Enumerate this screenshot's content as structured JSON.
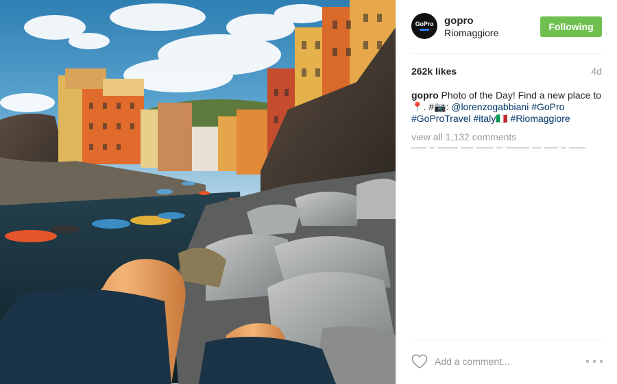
{
  "header": {
    "avatar_text": "GoPro",
    "username": "gopro",
    "location": "Riomaggiore",
    "follow_label": "Following"
  },
  "stats": {
    "likes": "262k likes",
    "age": "4d"
  },
  "caption": {
    "user": "gopro",
    "text_1": " Photo of the Day! Find a new place to ",
    "pin_emoji": "📍",
    "text_2": ". #",
    "camera_emoji": "📷",
    "text_3": ": ",
    "mention": "@lorenzogabbiani",
    "text_4": " ",
    "tag_1": "#GoPro",
    "text_5": " ",
    "tag_2": "#GoProTravel",
    "text_6": " ",
    "tag_3": "#italy",
    "flag_emoji": "🇮🇹",
    "text_7": " ",
    "tag_4": "#Riomaggiore"
  },
  "comments": {
    "view_all": "view all 1,132 comments"
  },
  "footer": {
    "comment_placeholder": "Add a comment..."
  },
  "colors": {
    "follow_green": "#70c050",
    "hashtag_blue": "#003569",
    "muted_gray": "#999999"
  },
  "icons": {
    "heart": "heart-outline-icon",
    "more": "more-options-icon"
  }
}
